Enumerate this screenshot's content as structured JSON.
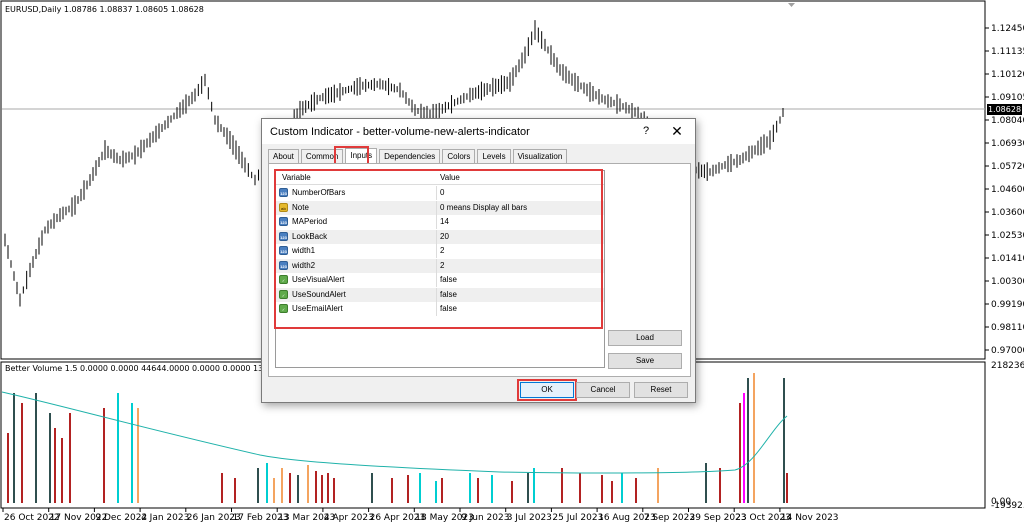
{
  "chart": {
    "header": "EURUSD,Daily  1.08786 1.08837 1.08605 1.08628",
    "current_price": "1.08628",
    "price_axis": [
      "1.12450",
      "1.11135",
      "1.10120",
      "1.09105",
      "1.08040",
      "1.06930",
      "1.05720",
      "1.04600",
      "1.03600",
      "1.02530",
      "1.01410",
      "1.00300",
      "0.99190",
      "0.98110",
      "0.97000"
    ],
    "date_axis": [
      "26 Oct 2022",
      "17 Nov 2022",
      "9 Dec 2022",
      "4 Jan 2023",
      "26 Jan 2023",
      "17 Feb 2023",
      "13 Mar 2023",
      "4 Apr 2023",
      "26 Apr 2023",
      "18 May 2023",
      "9 Jun 2023",
      "3 Jul 2023",
      "25 Jul 2023",
      "16 Aug 2023",
      "7 Sep 2023",
      "29 Sep 2023",
      "23 Oct 2023",
      "14 Nov 2023"
    ]
  },
  "subwindow": {
    "header": "Better Volume 1.5 0.0000 0.0000 44644.0000 0.0000 0.0000 133222.0000",
    "axis_top": "218236.2",
    "axis_bottom": "0.00",
    "axis_bottom2": "-19392.2"
  },
  "dialog": {
    "title": "Custom Indicator - better-volume-new-alerts-indicator",
    "help": "?",
    "close": "✕",
    "tabs": [
      "About",
      "Common",
      "Inputs",
      "Dependencies",
      "Colors",
      "Levels",
      "Visualization"
    ],
    "active_tab": "Inputs",
    "columns": {
      "variable": "Variable",
      "value": "Value"
    },
    "inputs": [
      {
        "type": "int",
        "icon": "123",
        "name": "NumberOfBars",
        "value": "0"
      },
      {
        "type": "str",
        "icon": "ab",
        "name": "Note",
        "value": "0 means Display all bars"
      },
      {
        "type": "int",
        "icon": "123",
        "name": "MAPeriod",
        "value": "14"
      },
      {
        "type": "int",
        "icon": "123",
        "name": "LookBack",
        "value": "20"
      },
      {
        "type": "int",
        "icon": "123",
        "name": "width1",
        "value": "2"
      },
      {
        "type": "int",
        "icon": "123",
        "name": "width2",
        "value": "2"
      },
      {
        "type": "bool",
        "icon": "✓",
        "name": "UseVisualAlert",
        "value": "false"
      },
      {
        "type": "bool",
        "icon": "✓",
        "name": "UseSoundAlert",
        "value": "false"
      },
      {
        "type": "bool",
        "icon": "✓",
        "name": "UseEmailAlert",
        "value": "false"
      }
    ],
    "buttons": {
      "load": "Load",
      "save": "Save",
      "ok": "OK",
      "cancel": "Cancel",
      "reset": "Reset"
    }
  },
  "colors": {
    "highlight": "#e03a3a",
    "volume_dark": "#2f4f4f",
    "volume_red": "#b22222",
    "volume_cyan": "#00ced1",
    "volume_orange": "#f4a460",
    "volume_magenta": "#ff00ff",
    "ma_line": "#20b2aa"
  }
}
